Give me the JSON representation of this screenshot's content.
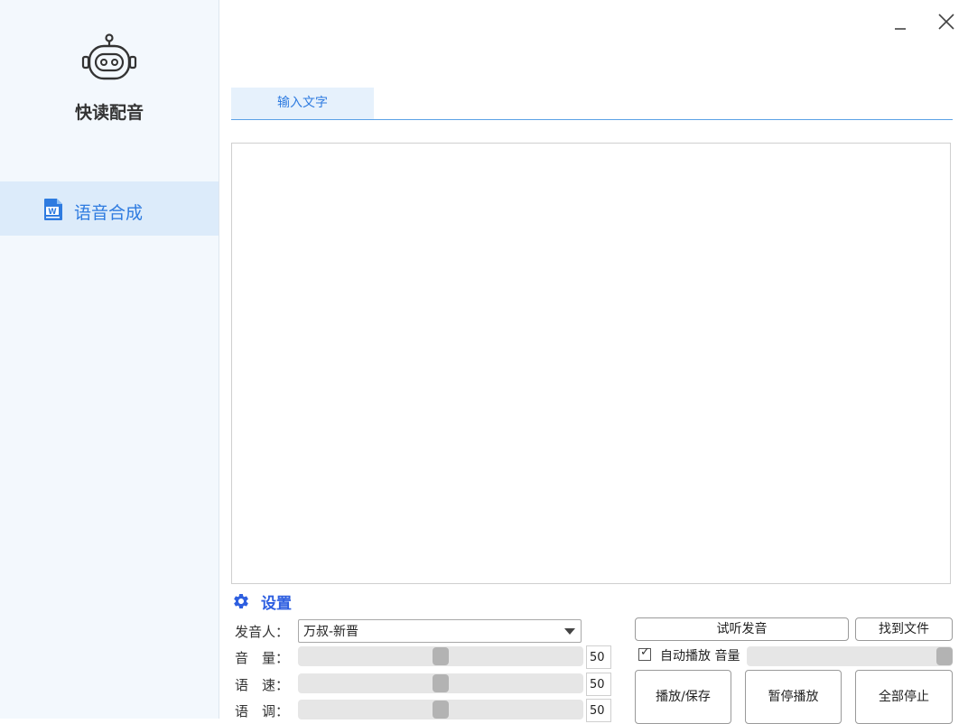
{
  "app": {
    "title": "快读配音"
  },
  "window": {
    "minimize_icon": "minimize-icon",
    "close_icon": "close-icon"
  },
  "sidebar": {
    "items": [
      {
        "label": "语音合成",
        "icon": "word-document-icon",
        "active": true
      }
    ]
  },
  "tabs": [
    {
      "label": "输入文字",
      "active": true
    }
  ],
  "editor": {
    "value": ""
  },
  "settings": {
    "title": "设置",
    "speaker": {
      "label": "发音人：",
      "value": "万叔-新晋"
    },
    "volume": {
      "label": "音　量：",
      "value": "50",
      "level": 0.5
    },
    "speed": {
      "label": "语　速：",
      "value": "50",
      "level": 0.5
    },
    "pitch": {
      "label": "语　调：",
      "value": "50",
      "level": 0.5
    }
  },
  "actions": {
    "preview": "试听发音",
    "find_file": "找到文件",
    "auto_play_label": "自动播放",
    "auto_play_checked": true,
    "playback_volume_label": "音量",
    "playback_volume_level": 1.0,
    "play_save": "播放/保存",
    "pause": "暂停播放",
    "stop_all": "全部停止"
  },
  "colors": {
    "accent": "#2e7be0",
    "settings_accent": "#2e5fe0",
    "sidebar_bg": "#f3f8fd",
    "active_nav_bg": "#dcebfa"
  }
}
